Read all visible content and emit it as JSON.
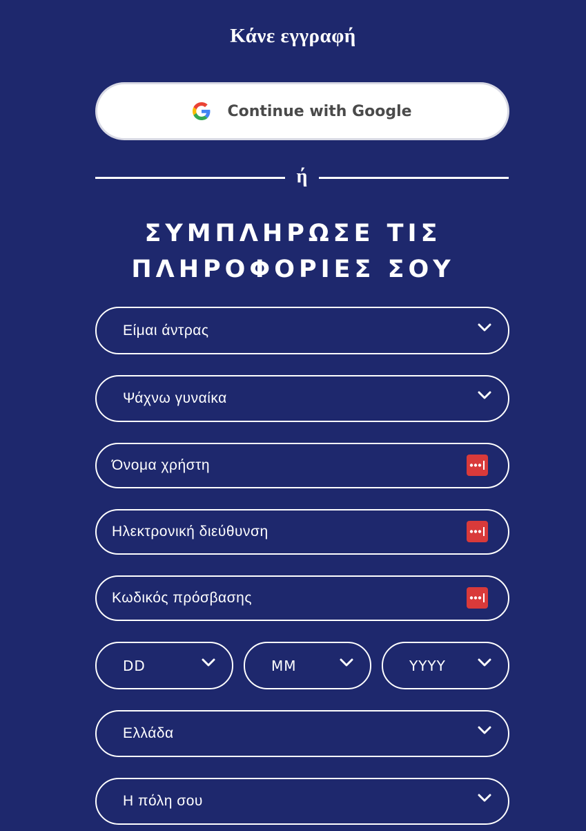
{
  "signup": {
    "title": "Κάνε εγγραφή"
  },
  "google_button": {
    "label": "Continue with Google",
    "icon": "google-icon",
    "colors": {
      "blue": "#4285F4",
      "red": "#EA4335",
      "yellow": "#FBBC05",
      "green": "#34A853"
    }
  },
  "divider": {
    "text": "ή"
  },
  "heading": {
    "line1": "ΣΥΜΠΛΗΡΩΣΕ ΤΙΣ",
    "line2": "ΠΛΗΡΟΦΟΡΙΕΣ ΣΟΥ"
  },
  "form": {
    "gender": {
      "value": "Είμαι άντρας",
      "icon": "chevron-down-icon"
    },
    "seeking": {
      "value": "Ψάχνω γυναίκα",
      "icon": "chevron-down-icon"
    },
    "username": {
      "placeholder": "Όνομα χρήστη",
      "icon": "password-manager-icon"
    },
    "email": {
      "placeholder": "Ηλεκτρονική διεύθυνση",
      "icon": "password-manager-icon"
    },
    "password": {
      "placeholder": "Κωδικός πρόσβασης",
      "icon": "password-manager-icon"
    },
    "birth_day": {
      "value": "DD",
      "icon": "chevron-down-icon"
    },
    "birth_month": {
      "value": "MM",
      "icon": "chevron-down-icon"
    },
    "birth_year": {
      "value": "YYYY",
      "icon": "chevron-down-icon"
    },
    "country": {
      "value": "Ελλάδα",
      "icon": "chevron-down-icon"
    },
    "city": {
      "value": "Η πόλη σου",
      "icon": "chevron-down-icon"
    }
  },
  "theme": {
    "background": "#1e286d",
    "text": "#ffffff",
    "password_manager_icon": "#d93a3a"
  }
}
